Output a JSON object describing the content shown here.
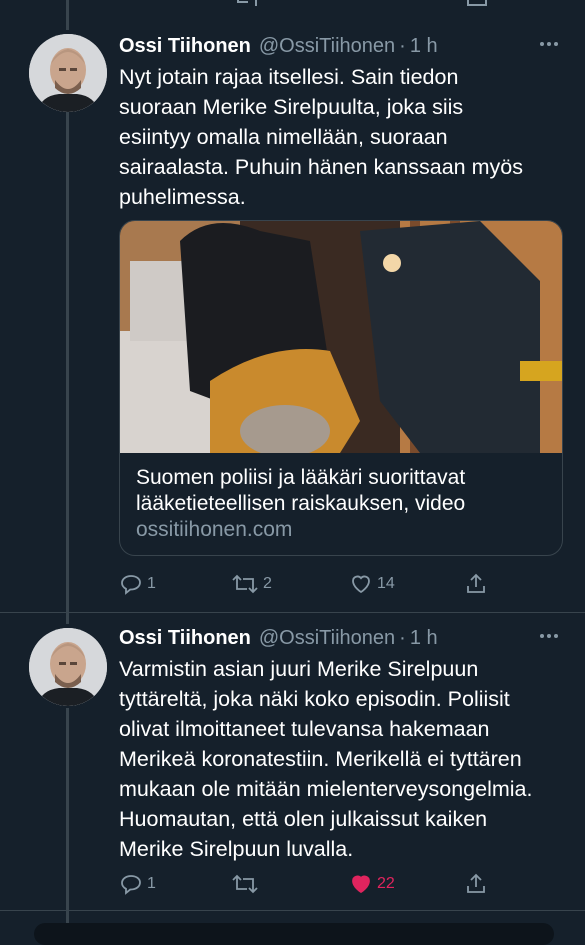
{
  "tweets": [
    {
      "display_name": "Ossi Tiihonen",
      "handle": "@OssiTiihonen",
      "separator": "·",
      "time": "1 h",
      "text": "Nyt jotain rajaa itsellesi. Sain tiedon\nsuoraan Merike Sirelpuulta, joka siis\nesiintyy omalla nimellään, suoraan\nsairaalasta. Puhuin hänen kanssaan myös\npuhelimessa.",
      "card": {
        "title": "Suomen poliisi ja lääkäri suorittavat\nlääketieteellisen raiskauksen, video",
        "domain": "ossitiihonen.com"
      },
      "actions": {
        "reply_count": "1",
        "retweet_count": "2",
        "like_count": "14",
        "liked": false
      }
    },
    {
      "display_name": "Ossi Tiihonen",
      "handle": "@OssiTiihonen",
      "separator": "·",
      "time": "1 h",
      "text": "Varmistin asian juuri Merike Sirelpuun\ntyttäreltä, joka näki koko episodin. Poliisit\nolivat ilmoittaneet tulevansa hakemaan\nMerikeä koronatestiin. Merikellä ei tyttären\nmukaan ole mitään mielenterveysongelmia.\nHuomautan, että olen julkaissut kaiken\nMerike Sirelpuun luvalla.",
      "actions": {
        "reply_count": "1",
        "retweet_count": "",
        "like_count": "22",
        "liked": true
      }
    }
  ],
  "colors": {
    "background": "#15202b",
    "secondary_text": "#8899a6",
    "border": "#38444d",
    "like_active": "#e0245e"
  },
  "icons": {
    "reply": "reply-icon",
    "retweet": "retweet-icon",
    "like": "heart-icon",
    "share": "share-icon",
    "more": "more-icon"
  }
}
